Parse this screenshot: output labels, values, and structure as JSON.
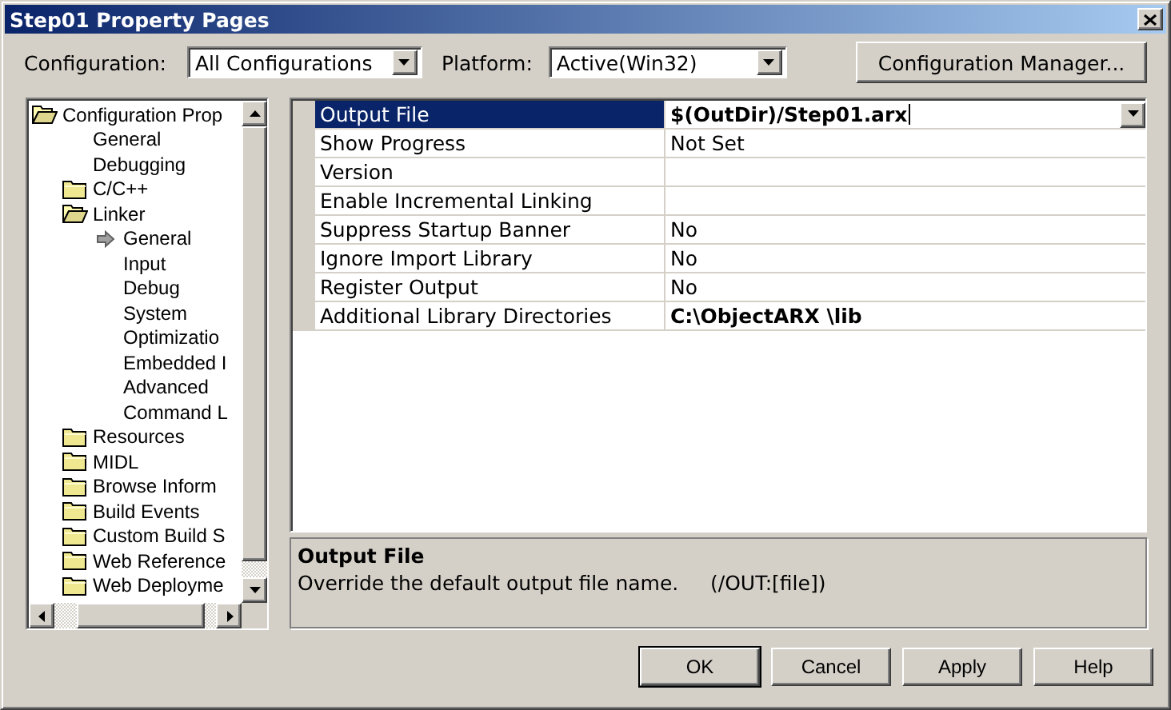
{
  "window": {
    "title": "Step01 Property Pages"
  },
  "configuration": {
    "label": "Configuration:",
    "value": "All Configurations"
  },
  "platform": {
    "label": "Platform:",
    "value": "Active(Win32)"
  },
  "manager_button": "Configuration Manager...",
  "tree": {
    "items": [
      {
        "label": "Configuration Prop",
        "kind": "folder",
        "expanded": true,
        "selected": false,
        "children": [
          {
            "label": "General",
            "kind": "page",
            "selected": false
          },
          {
            "label": "Debugging",
            "kind": "page",
            "selected": false
          },
          {
            "label": "C/C++",
            "kind": "folder",
            "expanded": false,
            "selected": false
          },
          {
            "label": "Linker",
            "kind": "folder",
            "expanded": true,
            "selected": false,
            "children": [
              {
                "label": "General",
                "kind": "page",
                "selected": true
              },
              {
                "label": "Input",
                "kind": "page",
                "selected": false
              },
              {
                "label": "Debug",
                "kind": "page",
                "selected": false
              },
              {
                "label": "System",
                "kind": "page",
                "selected": false
              },
              {
                "label": "Optimizatio",
                "kind": "page",
                "selected": false
              },
              {
                "label": "Embedded I",
                "kind": "page",
                "selected": false
              },
              {
                "label": "Advanced",
                "kind": "page",
                "selected": false
              },
              {
                "label": "Command L",
                "kind": "page",
                "selected": false
              }
            ]
          },
          {
            "label": "Resources",
            "kind": "folder",
            "expanded": false,
            "selected": false
          },
          {
            "label": "MIDL",
            "kind": "folder",
            "expanded": false,
            "selected": false
          },
          {
            "label": "Browse Inform",
            "kind": "folder",
            "expanded": false,
            "selected": false
          },
          {
            "label": "Build Events",
            "kind": "folder",
            "expanded": false,
            "selected": false
          },
          {
            "label": "Custom Build S",
            "kind": "folder",
            "expanded": false,
            "selected": false
          },
          {
            "label": "Web Reference",
            "kind": "folder",
            "expanded": false,
            "selected": false
          },
          {
            "label": "Web Deployme",
            "kind": "folder",
            "expanded": false,
            "selected": false
          }
        ]
      }
    ]
  },
  "properties": [
    {
      "name": "Output File",
      "value": "$(OutDir)/Step01.arx",
      "selected": true,
      "modified": true
    },
    {
      "name": "Show Progress",
      "value": "Not Set",
      "selected": false,
      "modified": false
    },
    {
      "name": "Version",
      "selected": false,
      "modified": false
    },
    {
      "name": "Enable Incremental Linking",
      "selected": false,
      "modified": false
    },
    {
      "name": "Suppress Startup Banner",
      "value": "No",
      "selected": false,
      "modified": false
    },
    {
      "name": "Ignore Import Library",
      "value": "No",
      "selected": false,
      "modified": false
    },
    {
      "name": "Register Output",
      "value": "No",
      "selected": false,
      "modified": false
    },
    {
      "name": "Additional Library Directories",
      "value": "C:\\ObjectARX \\lib",
      "selected": false,
      "modified": true
    }
  ],
  "description": {
    "title": "Output File",
    "text": "Override the default output file name.     (/OUT:[file])"
  },
  "buttons": [
    {
      "label": "OK",
      "default": true
    },
    {
      "label": "Cancel",
      "default": false
    },
    {
      "label": "Apply",
      "default": false
    },
    {
      "label": "Help",
      "default": false
    }
  ]
}
